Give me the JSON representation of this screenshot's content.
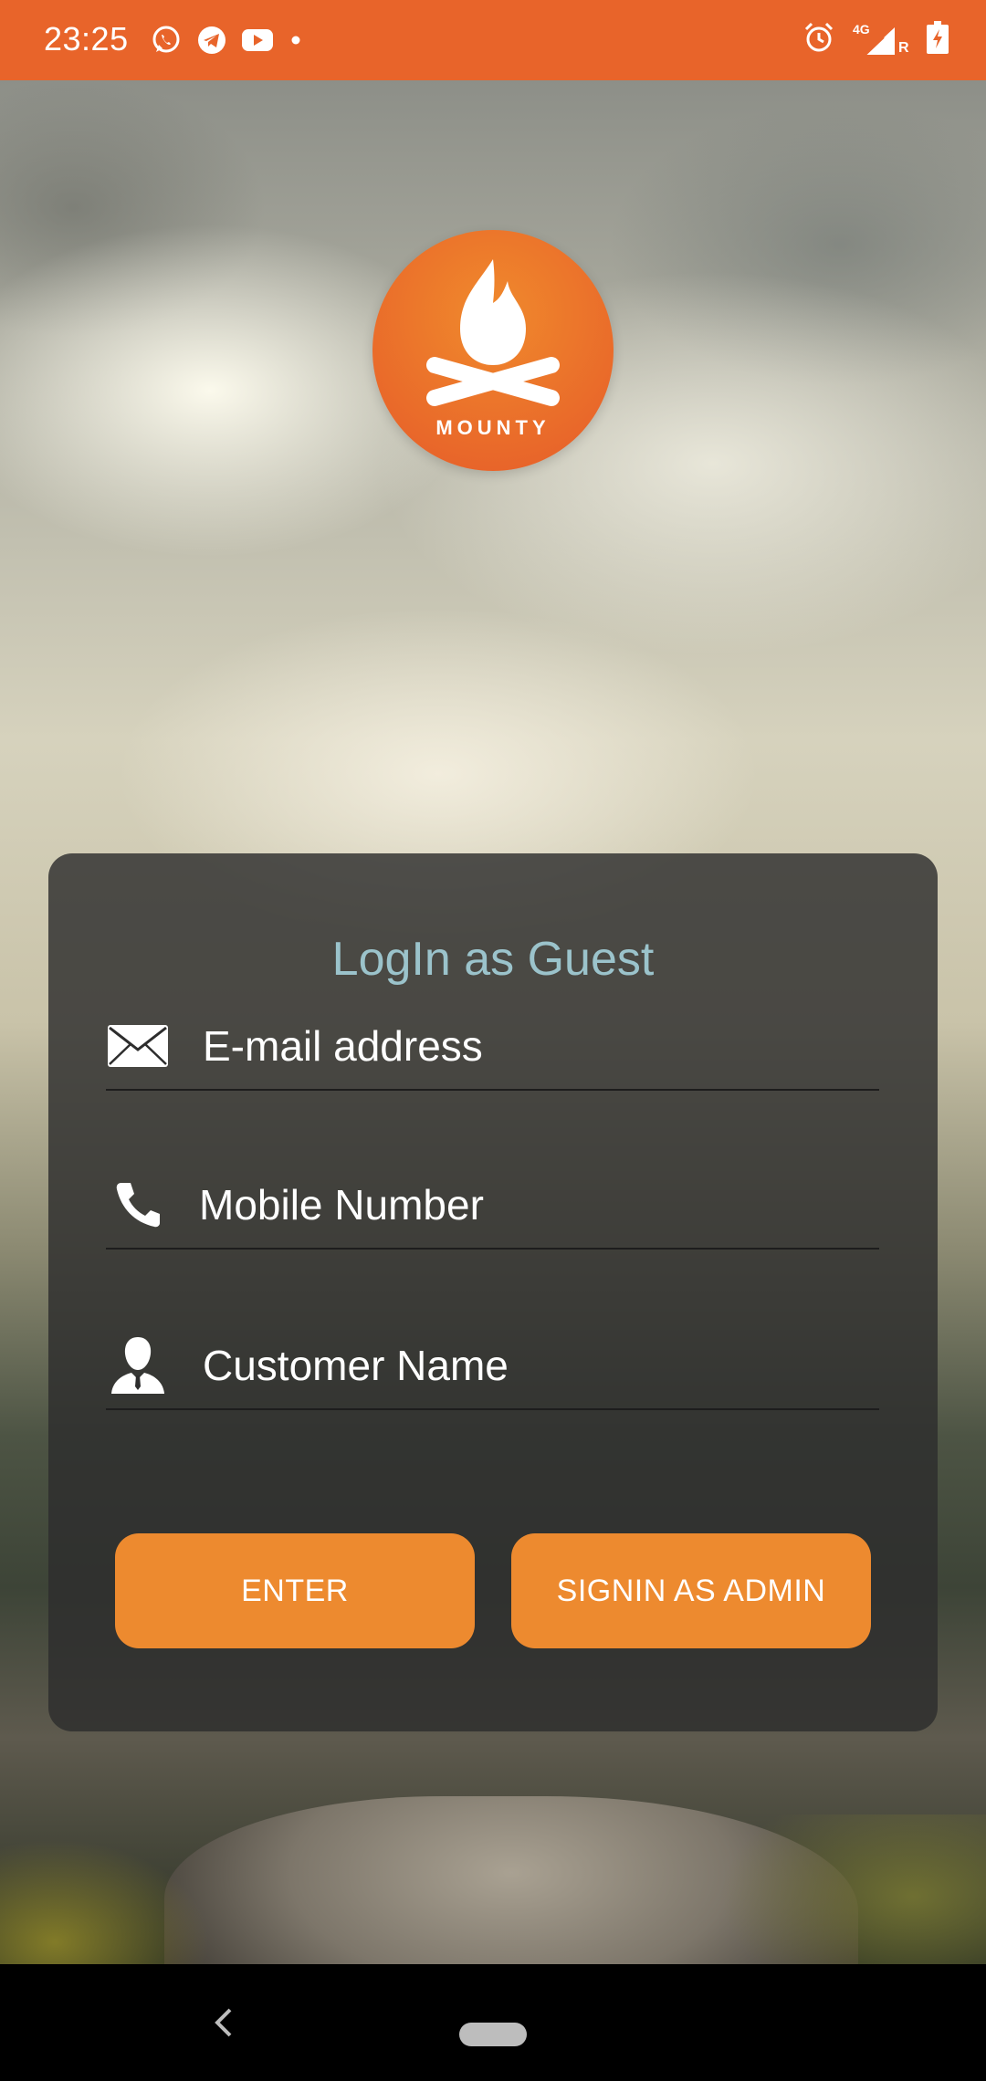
{
  "status_bar": {
    "time": "23:25",
    "network_label": "4G",
    "roaming_label": "R",
    "icons": [
      "whatsapp-icon",
      "telegram-icon",
      "youtube-icon",
      "dot-icon",
      "alarm-icon",
      "signal-icon",
      "battery-icon"
    ],
    "color": "#e8642a"
  },
  "logo": {
    "text": "MOUNTY",
    "color": "#e8642a"
  },
  "login_card": {
    "title": "LogIn as Guest",
    "title_color": "#9bc3cb",
    "email": {
      "placeholder": "E-mail address",
      "value": ""
    },
    "mobile": {
      "placeholder": "Mobile Number",
      "value": ""
    },
    "name": {
      "placeholder": "Customer Name",
      "value": ""
    },
    "enter_label": "ENTER",
    "admin_label": "SIGNIN AS ADMIN",
    "button_color": "#ed8a2f"
  },
  "nav_bar": {
    "icons": [
      "back-icon",
      "home-pill-icon"
    ]
  }
}
